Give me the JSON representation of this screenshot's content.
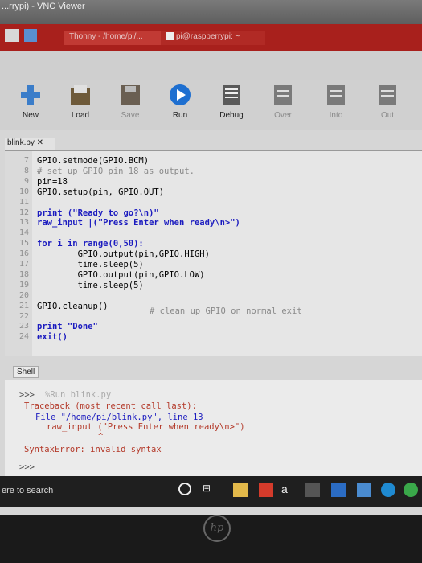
{
  "vnc": {
    "title": "...rrypi) - VNC Viewer"
  },
  "taskbar": {
    "items": [
      "Thonny - /home/pi/...",
      "pi@raspberrypi: ~"
    ]
  },
  "toolbar": {
    "buttons": [
      {
        "label": "New",
        "icon": "plus-icon",
        "enabled": true
      },
      {
        "label": "Load",
        "icon": "folder-icon",
        "enabled": true
      },
      {
        "label": "Save",
        "icon": "floppy-icon",
        "enabled": false
      },
      {
        "label": "Run",
        "icon": "play-icon",
        "enabled": true
      },
      {
        "label": "Debug",
        "icon": "debug-icon",
        "enabled": true
      },
      {
        "label": "Over",
        "icon": "step-over-icon",
        "enabled": false
      },
      {
        "label": "Into",
        "icon": "step-into-icon",
        "enabled": false
      },
      {
        "label": "Out",
        "icon": "step-out-icon",
        "enabled": false
      }
    ]
  },
  "editor": {
    "tab_label": "blink.py ✕",
    "lines": [
      {
        "n": "7",
        "text": "GPIO.setmode(GPIO.BCM)"
      },
      {
        "n": "8",
        "text": "# set up GPIO pin 18 as output."
      },
      {
        "n": "9",
        "text": "pin=18"
      },
      {
        "n": "10",
        "text": "GPIO.setup(pin, GPIO.OUT)"
      },
      {
        "n": "11",
        "text": ""
      },
      {
        "n": "12",
        "text": "print (\"Ready to go?\\n)\""
      },
      {
        "n": "13",
        "text": "raw_input |(\"Press Enter when ready\\n>\")"
      },
      {
        "n": "14",
        "text": ""
      },
      {
        "n": "15",
        "text": "for i in range(0,50):"
      },
      {
        "n": "16",
        "text": "        GPIO.output(pin,GPIO.HIGH)"
      },
      {
        "n": "17",
        "text": "        time.sleep(5)"
      },
      {
        "n": "18",
        "text": "        GPIO.output(pin,GPIO.LOW)"
      },
      {
        "n": "19",
        "text": "        time.sleep(5)"
      },
      {
        "n": "20",
        "text": ""
      },
      {
        "n": "21",
        "text": "GPIO.cleanup()"
      },
      {
        "n": "22",
        "text": ""
      },
      {
        "n": "23",
        "text": "print \"Done\""
      },
      {
        "n": "24",
        "text": "exit()"
      }
    ],
    "comment_21": "# clean up GPIO on normal exit"
  },
  "shell": {
    "tab_label": "Shell",
    "prompt": ">>>",
    "run_cmd": "%Run blink.py",
    "traceback": "Traceback (most recent call last):",
    "file_line": "File \"/home/pi/blink.py\", line 13",
    "src_line": "raw_input (\"Press Enter when ready\\n>\")",
    "caret": "^",
    "error": "SyntaxError: invalid syntax",
    "prompt2": ">>>"
  },
  "wintaskbar": {
    "search": "ere to search"
  },
  "bezel": {
    "logo": "hp"
  },
  "colors": {
    "taskbar": "#a8201c",
    "run_blue": "#1e6fd0",
    "keyword": "#1b1bbf"
  }
}
